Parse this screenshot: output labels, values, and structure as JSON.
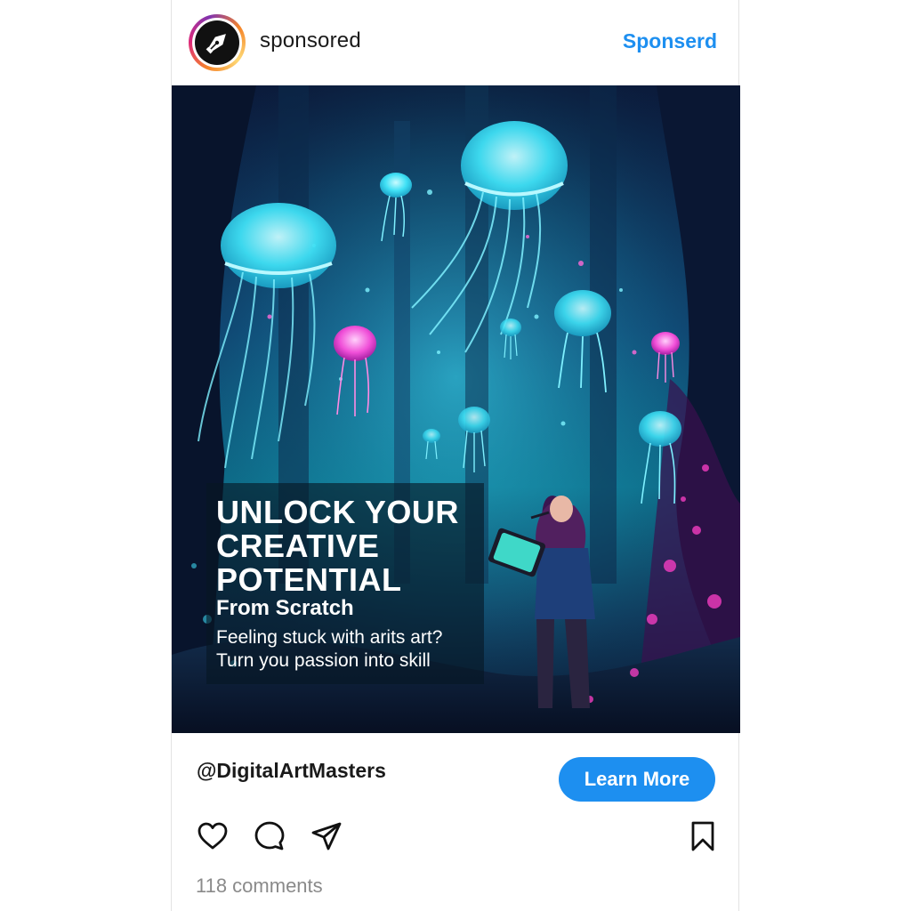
{
  "colors": {
    "accent": "#1d8ff0",
    "headline_text": "#ffffff",
    "muted_text": "#8a8a8a"
  },
  "header": {
    "username": "sponsored",
    "sponsored_link": "Sponserd",
    "avatar_icon": "pen-nib-icon"
  },
  "ad": {
    "headline_lines": [
      "UNLOCK YOUR",
      "CREATIVE",
      "POTENTIAL"
    ],
    "sub_headline": "From Scratch",
    "body_lines": [
      "Feeling stuck with arits art?",
      "Turn you passion into skill"
    ]
  },
  "cta_row": {
    "handle": "@DigitalArtMasters",
    "button_label": "Learn More"
  },
  "actions": {
    "icons": [
      "heart-icon",
      "comment-icon",
      "share-icon",
      "bookmark-icon"
    ]
  },
  "footer": {
    "comments": "118 comments"
  }
}
